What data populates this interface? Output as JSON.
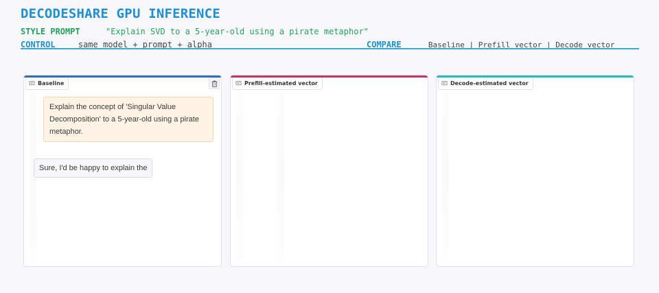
{
  "header": {
    "title": "DECODESHARE GPU INFERENCE",
    "style_prompt_label": "STYLE PROMPT",
    "style_prompt_value": "\"Explain SVD to a 5-year-old using a pirate metaphor\"",
    "control_label": "CONTROL",
    "control_value": "same model + prompt + alpha",
    "compare_label": "COMPARE",
    "compare_value": "Baseline | Prefill vector | Decode vector"
  },
  "colors": {
    "title": "#1f8fd0",
    "green": "#22a25a",
    "rule": "#3aa6cf",
    "baseline_accent": "#2f6fb5",
    "prefill_accent": "#c2355e",
    "decode_accent": "#2bb6c4"
  },
  "panels": [
    {
      "label": "Baseline",
      "icon": "chat-icon",
      "has_clear": true,
      "user_message": "Explain the concept of 'Singular Value Decomposition' to a 5-year-old using a pirate metaphor.",
      "bot_message": "Sure, I'd be happy to explain the"
    },
    {
      "label": "Prefill-estimated vector",
      "icon": "chat-icon",
      "has_clear": false
    },
    {
      "label": "Decode-estimated vector",
      "icon": "chat-icon",
      "has_clear": false
    }
  ]
}
